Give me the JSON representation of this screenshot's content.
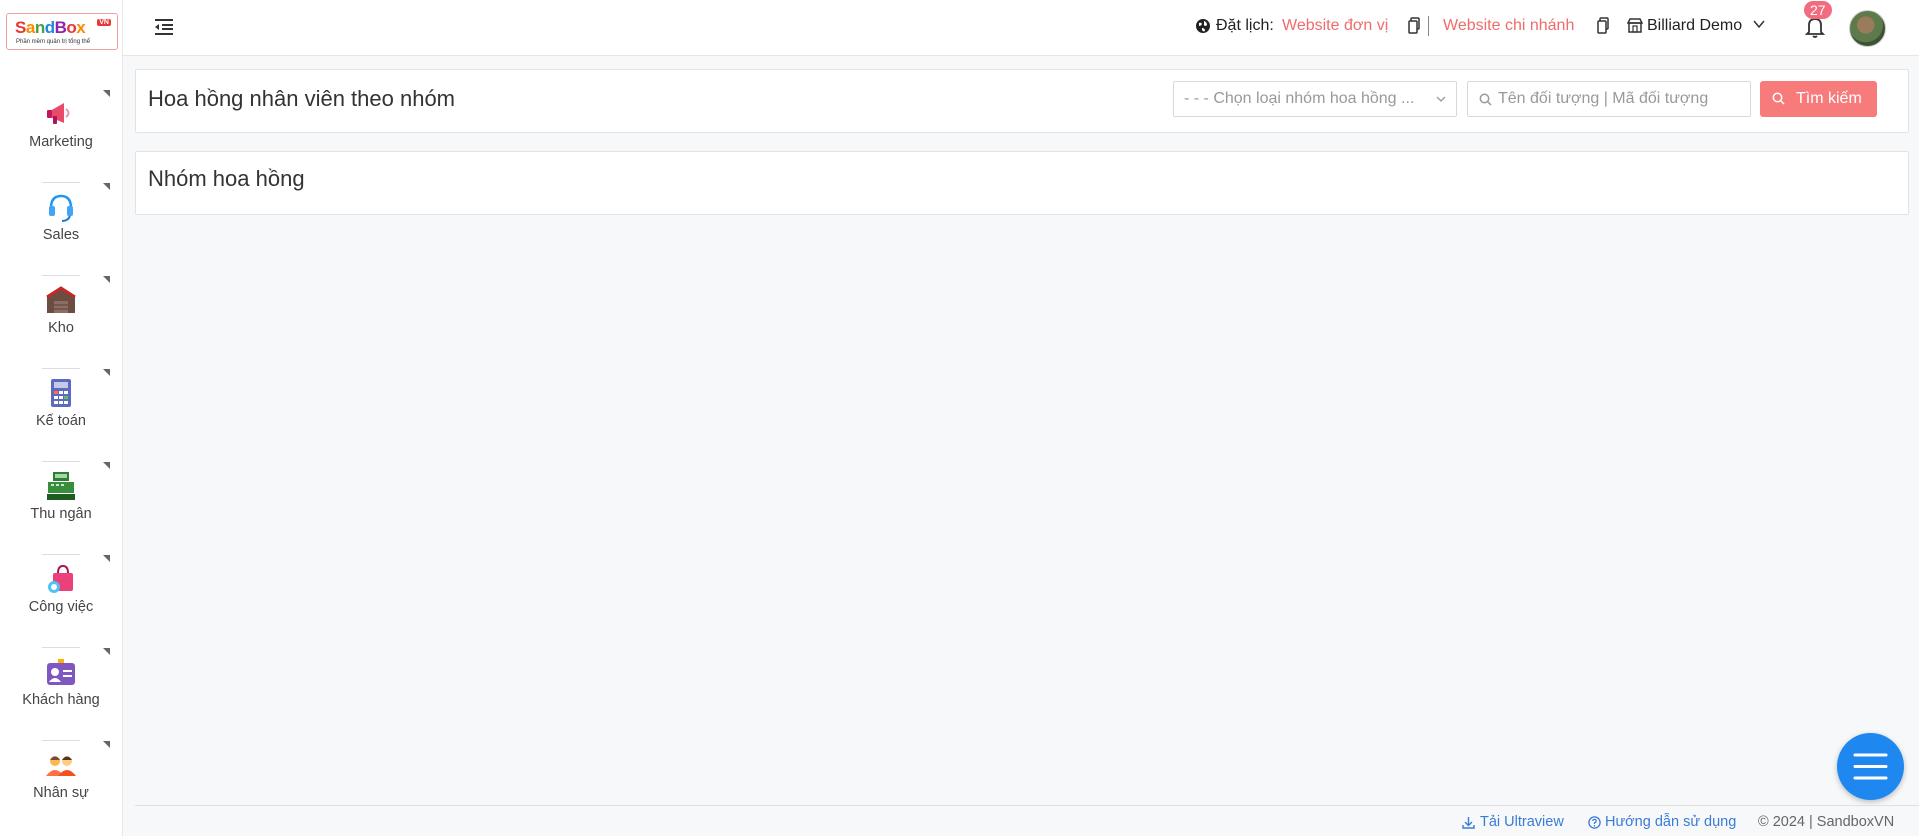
{
  "brand": {
    "letters": [
      "S",
      "a",
      "n",
      "d",
      "B",
      "o",
      "x"
    ],
    "suffix": "VN",
    "tagline": "Phần mềm quản trị tổng thể"
  },
  "sidebar": {
    "items": [
      {
        "label": "Marketing",
        "icon": "megaphone-icon"
      },
      {
        "label": "Sales",
        "icon": "headset-icon"
      },
      {
        "label": "Kho",
        "icon": "warehouse-icon"
      },
      {
        "label": "Kế toán",
        "icon": "calculator-icon"
      },
      {
        "label": "Thu ngân",
        "icon": "cash-register-icon"
      },
      {
        "label": "Công việc",
        "icon": "shopping-bag-icon"
      },
      {
        "label": "Khách hàng",
        "icon": "id-card-icon"
      },
      {
        "label": "Nhân sự",
        "icon": "people-icon"
      }
    ]
  },
  "header": {
    "booking_label": "Đặt lịch:",
    "website_unit": "Website đơn vị",
    "website_branch": "Website chi nhánh",
    "store_name": "Billiard Demo",
    "notification_count": "27"
  },
  "filter_card": {
    "title": "Hoa hồng nhân viên theo nhóm",
    "select_placeholder": "- - - Chọn loại nhóm hoa hồng ...",
    "search_placeholder": "Tên đối tượng | Mã đối tượng",
    "search_value": "",
    "search_button": "Tìm kiếm"
  },
  "group_card": {
    "title": "Nhóm hoa hồng"
  },
  "footer": {
    "download": "Tải Ultraview",
    "guide": "Hướng dẫn sử dụng",
    "copyright": "© 2024 | SandboxVN"
  },
  "colors": {
    "accent_red": "#f77b7b",
    "link_blue": "#3a7bd5",
    "fab_blue": "#1e88f0",
    "badge_pink": "#f36b7f"
  }
}
